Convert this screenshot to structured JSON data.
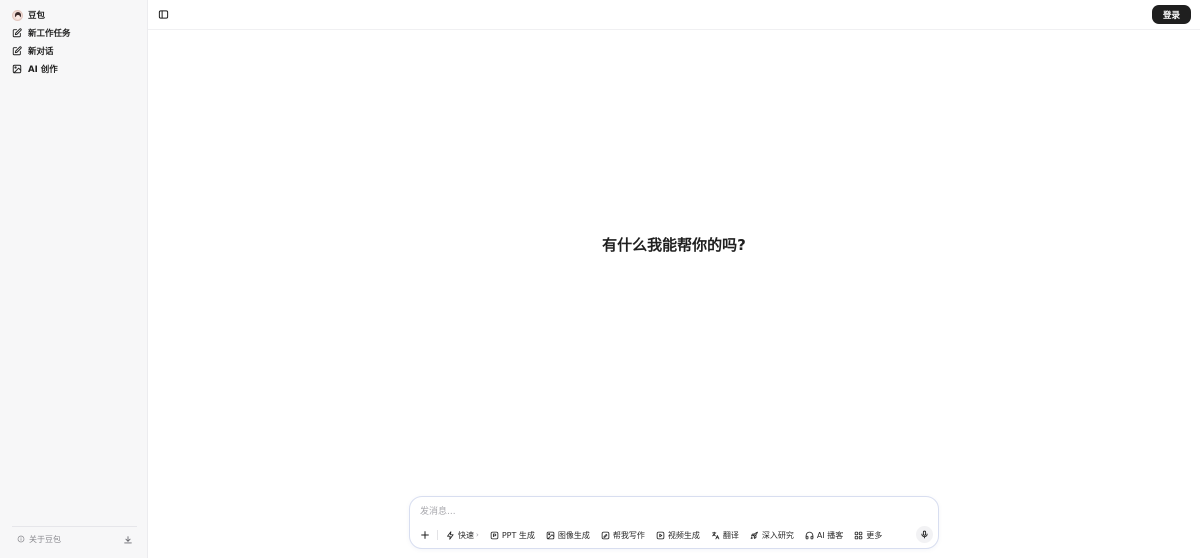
{
  "sidebar": {
    "brand": {
      "label": "豆包",
      "icon": "doubao-logo"
    },
    "items": [
      {
        "label": "新工作任务",
        "icon": "edit-icon"
      },
      {
        "label": "新对话",
        "icon": "edit-icon"
      },
      {
        "label": "AI 创作",
        "icon": "image-icon"
      }
    ],
    "footer": {
      "about_label": "关于豆包",
      "about_icon": "info-icon",
      "download_icon": "download-icon"
    }
  },
  "header": {
    "toggle_icon": "sidebar-toggle-icon",
    "login_label": "登录"
  },
  "main": {
    "hero_title": "有什么我能帮你的吗?"
  },
  "composer": {
    "placeholder": "发消息...",
    "mode_label": "快速",
    "tools": [
      {
        "label": "PPT 生成",
        "icon": "ppt-icon"
      },
      {
        "label": "图像生成",
        "icon": "image-icon"
      },
      {
        "label": "帮我写作",
        "icon": "write-icon"
      },
      {
        "label": "视频生成",
        "icon": "video-icon"
      },
      {
        "label": "翻译",
        "icon": "translate-icon"
      },
      {
        "label": "深入研究",
        "icon": "rocket-icon"
      },
      {
        "label": "AI 播客",
        "icon": "headphones-icon"
      },
      {
        "label": "更多",
        "icon": "grid-icon"
      }
    ]
  },
  "colors": {
    "accent": "#1f1f1f",
    "sidebar_bg": "#f7f7f8",
    "composer_border": "#d8def0"
  }
}
